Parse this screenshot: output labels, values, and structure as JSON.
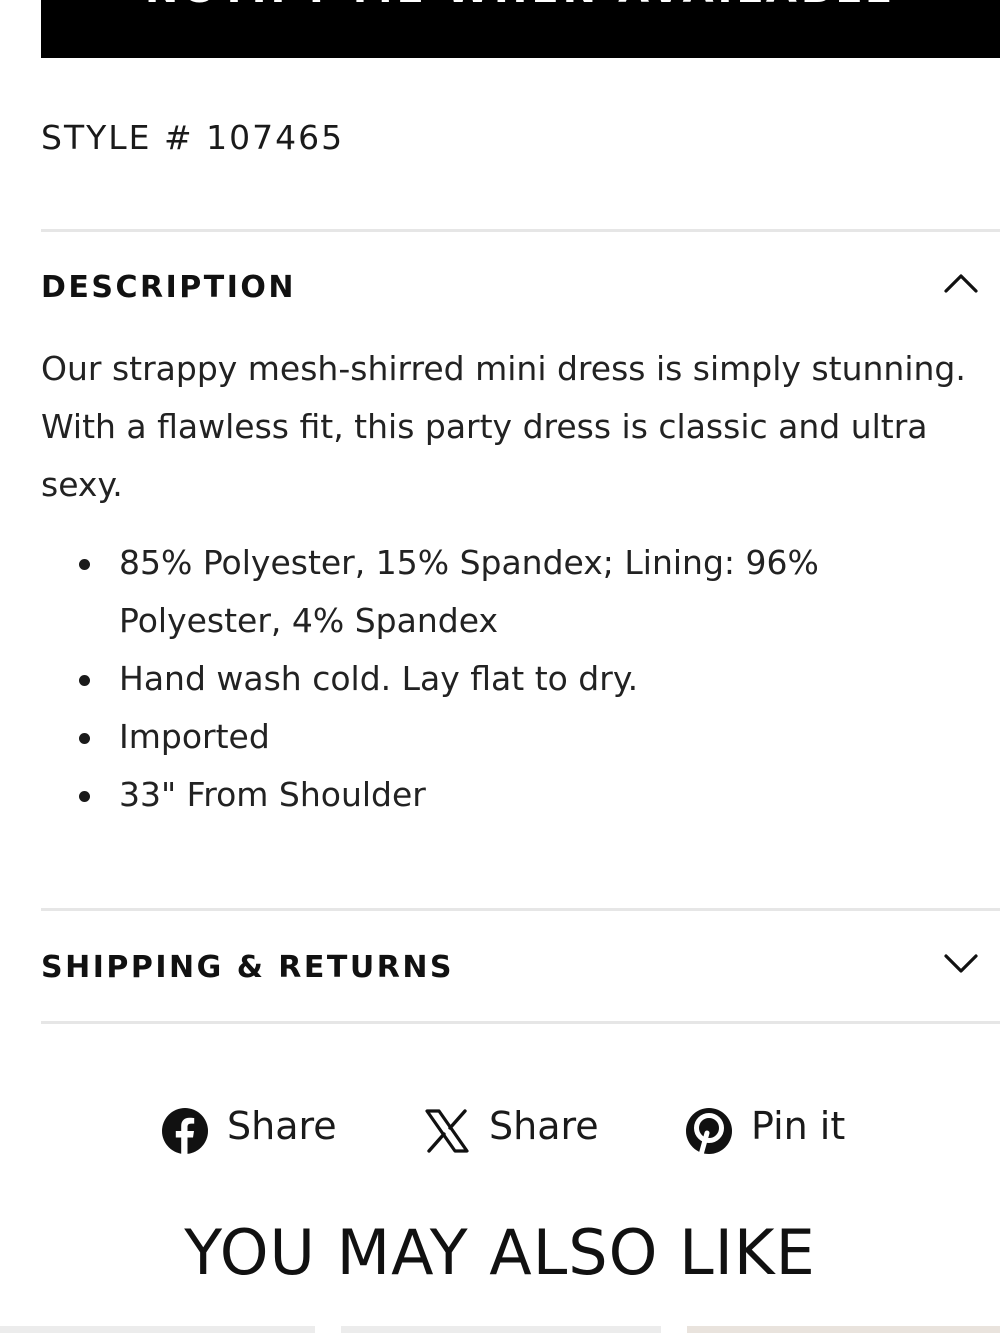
{
  "notify_button": {
    "label": "NOTIFY ME WHEN AVAILABLE"
  },
  "style_number": "STYLE # 107465",
  "description": {
    "title": "DESCRIPTION",
    "body": "Our strappy mesh-shirred mini dress is simply stunning. With a flawless fit, this party dress is classic and ultra sexy.",
    "details": [
      "85% Polyester, 15% Spandex; Lining: 96% Polyester, 4% Spandex",
      "Hand wash cold. Lay flat to dry.",
      "Imported",
      "33\" From Shoulder"
    ],
    "toggle_icon": "chevron-up-icon"
  },
  "shipping": {
    "title": "SHIPPING & RETURNS",
    "toggle_icon": "chevron-down-icon"
  },
  "share": {
    "facebook": {
      "label": "Share",
      "icon": "facebook-icon"
    },
    "x": {
      "label": "Share",
      "icon": "x-icon"
    },
    "pinterest": {
      "label": "Pin it",
      "icon": "pinterest-icon"
    }
  },
  "recommendations": {
    "title": "YOU MAY ALSO LIKE"
  },
  "colors": {
    "button_bg": "#000000",
    "divider": "#e6e6e6",
    "text": "#1a1a1a"
  }
}
